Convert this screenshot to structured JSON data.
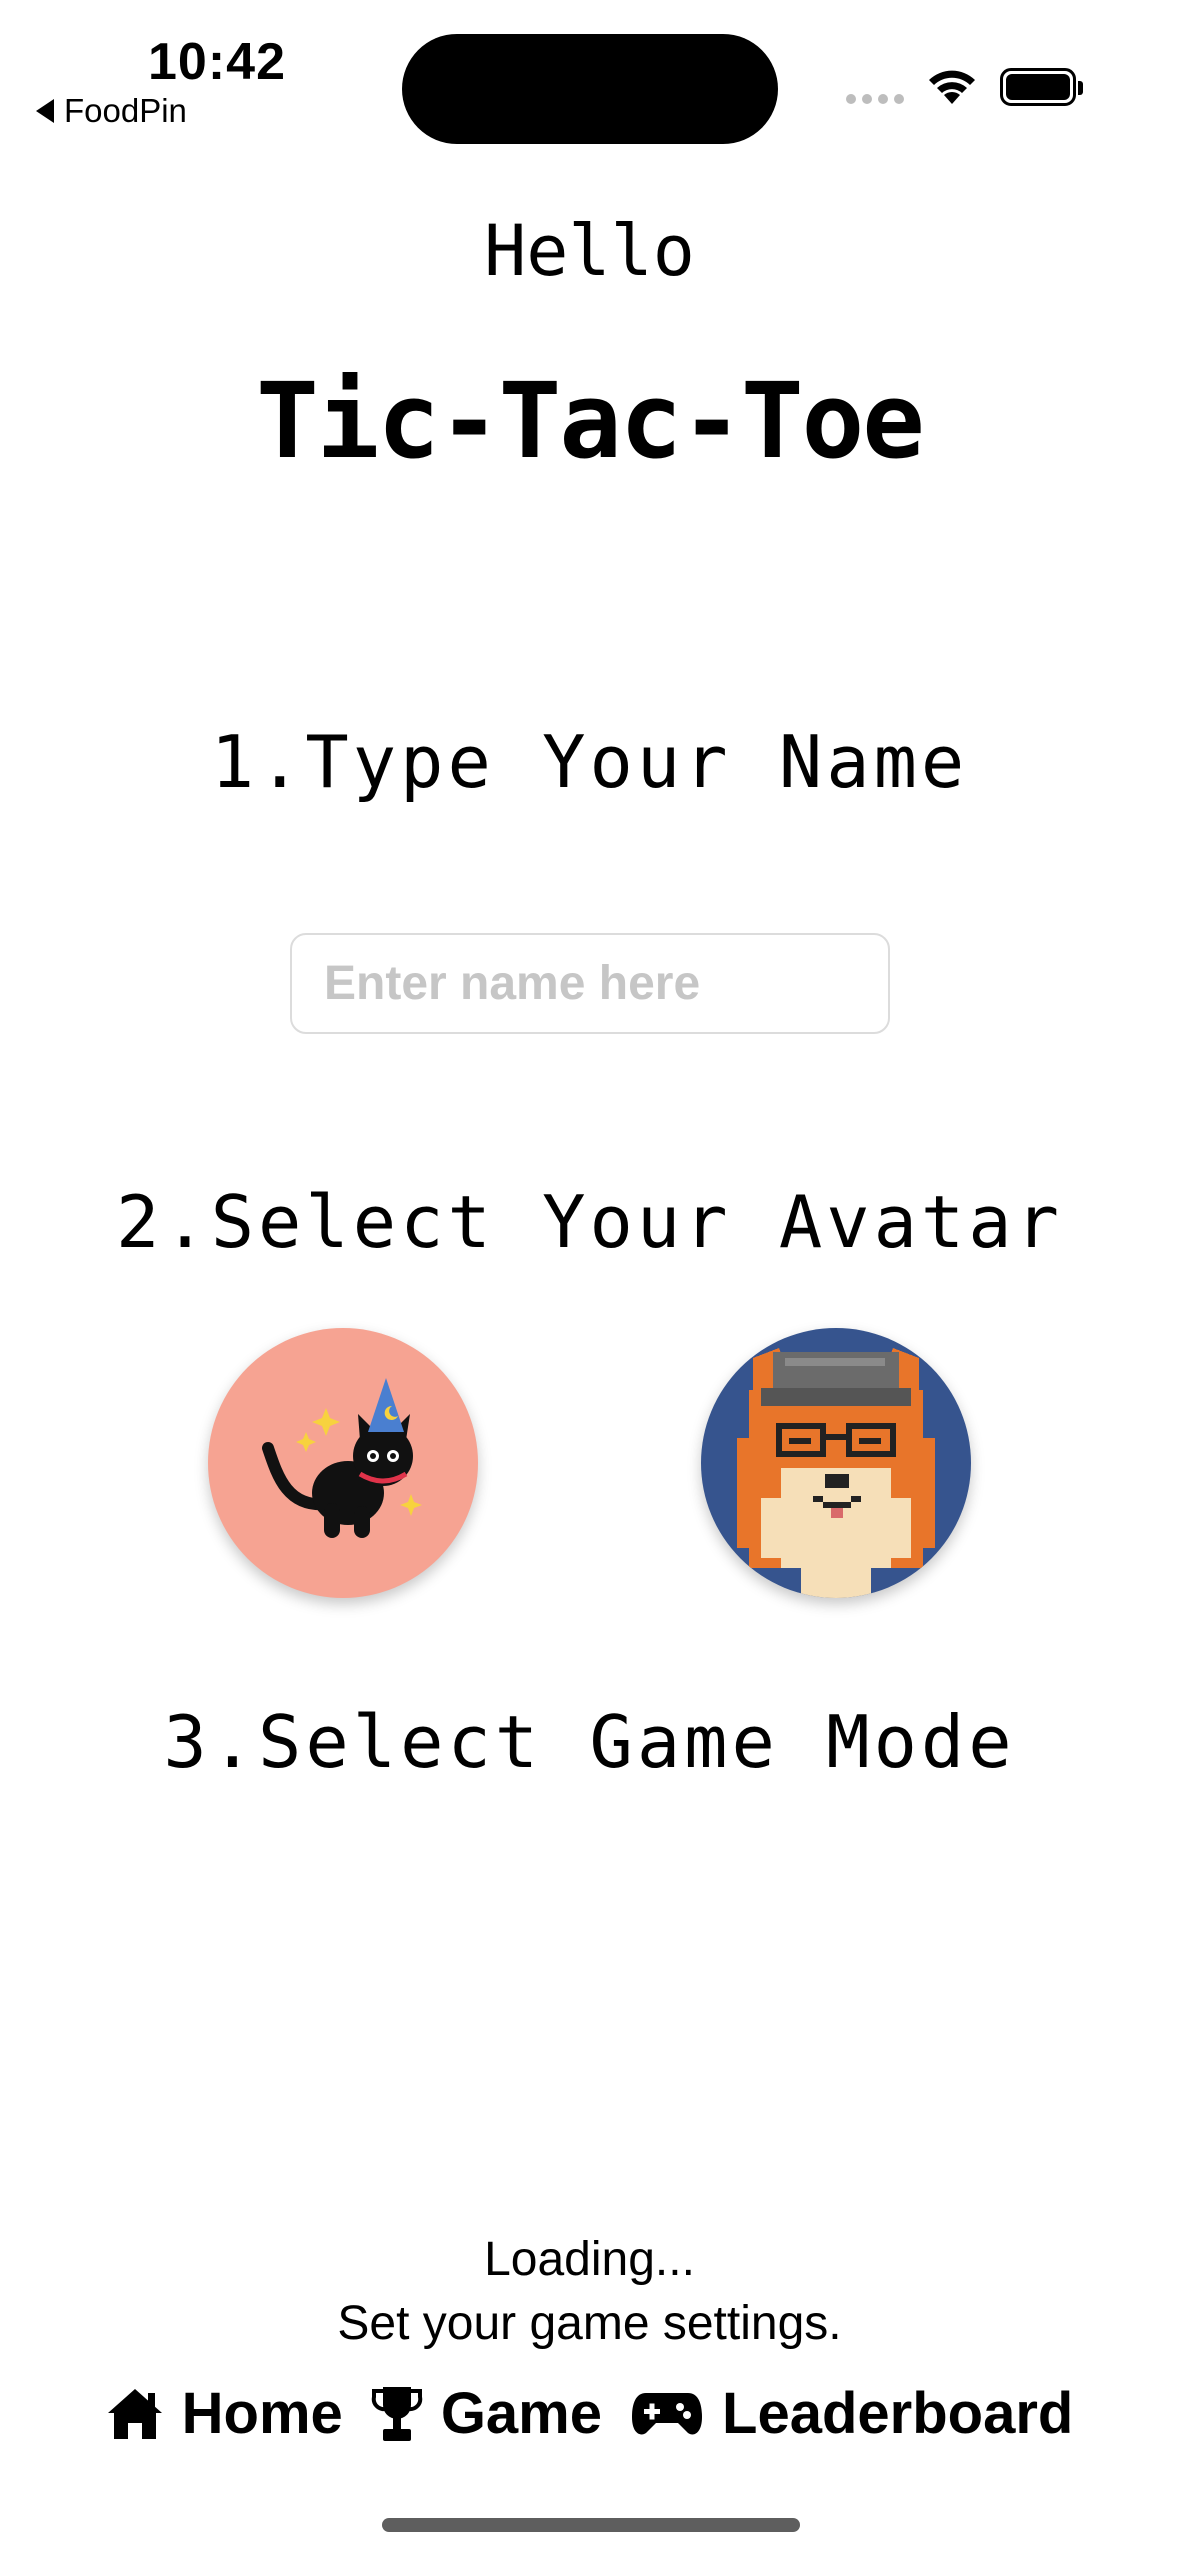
{
  "status_bar": {
    "time": "10:42",
    "back_label": "FoodPin"
  },
  "header": {
    "greeting": "Hello",
    "title": "Tic-Tac-Toe"
  },
  "steps": {
    "name_label": "1.Type Your Name",
    "name_placeholder": "Enter name here",
    "name_value": "",
    "avatar_label": "2.Select Your Avatar",
    "game_mode_label": "3.Select Game Mode"
  },
  "avatars": [
    {
      "id": "cat-wizard",
      "background": "#f6a392"
    },
    {
      "id": "shiba-glasses",
      "background": "#36548e"
    }
  ],
  "status": {
    "loading": "Loading...",
    "message": "Set your game settings."
  },
  "tabs": [
    {
      "label": "Home",
      "icon": "house-icon"
    },
    {
      "label": "Game",
      "icon": "trophy-icon"
    },
    {
      "label": "Leaderboard",
      "icon": "gamecontroller-icon"
    }
  ]
}
